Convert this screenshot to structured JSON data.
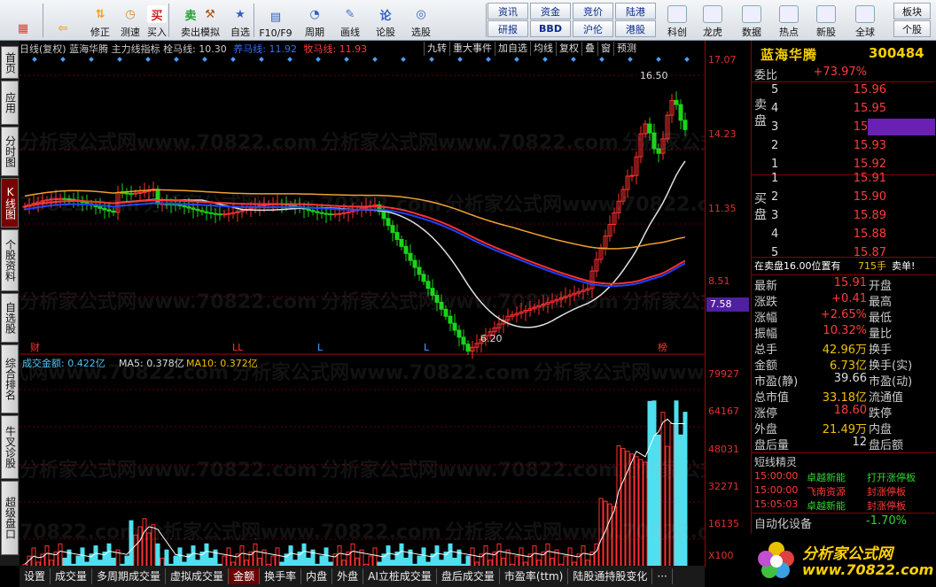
{
  "toolbar": {
    "items": [
      {
        "label": "",
        "icon": "grid-icon"
      },
      {
        "label": "",
        "icon": "back-arrow-icon"
      },
      {
        "label": "修正",
        "icon": "arrows-icon"
      },
      {
        "label": "测速",
        "icon": "clock-icon"
      },
      {
        "label": "买入",
        "icon": "buy-icon"
      },
      {
        "label": "卖出",
        "icon": "sell-icon"
      },
      {
        "label": "模拟",
        "icon": "hammer-icon"
      },
      {
        "label": "自选",
        "icon": "star-icon"
      },
      {
        "label": "F10/F9",
        "icon": "f10-icon"
      },
      {
        "label": "周期",
        "icon": "cycle-icon"
      },
      {
        "label": "画线",
        "icon": "pencil-icon"
      },
      {
        "label": "论股",
        "icon": "discuss-icon"
      },
      {
        "label": "选股",
        "icon": "select-icon"
      }
    ],
    "small": [
      [
        "资讯",
        "资金",
        "竞价",
        "陆港"
      ],
      [
        "研报",
        "BBD",
        "沪伦",
        "港股"
      ]
    ],
    "items2": [
      {
        "label": "科创",
        "icon": "chart-icon"
      },
      {
        "label": "龙虎",
        "icon": "dragon-icon"
      },
      {
        "label": "数据",
        "icon": "pe-icon"
      },
      {
        "label": "热点",
        "icon": "hot-icon"
      },
      {
        "label": "新股",
        "icon": "ipo-icon"
      },
      {
        "label": "全球",
        "icon": "globe-icon"
      }
    ],
    "right": [
      "板块",
      "个股"
    ]
  },
  "lefttabs": [
    "首页",
    "应用",
    "分时图",
    "K线图",
    "个股资料",
    "自选股",
    "综合排名",
    "牛叉诊股",
    "超级盘口"
  ],
  "chart_header": {
    "left": "日线(复权)  蓝海华腾  主力线指标  栓马线: 10.30",
    "yang": "养马线: 11.92",
    "mu": "牧马线: 11.93",
    "tabs": [
      "九转",
      "重大事件",
      "加自选",
      "均线",
      "复权",
      "叠",
      "窗",
      "预测"
    ]
  },
  "price_axis": [
    "17.07",
    "14.23",
    "11.35",
    "8.51"
  ],
  "price_tag": "7.58",
  "vol_axis": [
    "79927",
    "64167",
    "48031",
    "32271",
    "16135",
    "X100"
  ],
  "vol_header": {
    "a": "成交金额: 0.422亿",
    "b": "MA5: 0.378亿",
    "c": "MA10: 0.372亿"
  },
  "chart_labels": {
    "hi": "16.50",
    "lo": "6.20",
    "cai": "财",
    "bang": "榜",
    "l1": "LL",
    "l2": "L",
    "l3": "L"
  },
  "panel": {
    "name": "蓝海华腾",
    "code": "300484",
    "weibi_k": "委比",
    "weibi_v": "+73.97%",
    "sell_label": "卖盘",
    "buy_label": "买盘",
    "sell": [
      {
        "lv": "5",
        "p": "15.96"
      },
      {
        "lv": "4",
        "p": "15.95"
      },
      {
        "lv": "3",
        "p": "15.94"
      },
      {
        "lv": "2",
        "p": "15.93"
      },
      {
        "lv": "1",
        "p": "15.92"
      }
    ],
    "buy": [
      {
        "lv": "1",
        "p": "15.91"
      },
      {
        "lv": "2",
        "p": "15.90"
      },
      {
        "lv": "3",
        "p": "15.89"
      },
      {
        "lv": "4",
        "p": "15.88"
      },
      {
        "lv": "5",
        "p": "15.87"
      }
    ],
    "notice_a": "在卖盘16.00位置有",
    "notice_b": "715手",
    "notice_c": "卖单!",
    "stats": [
      {
        "k": "最新",
        "v": "15.91",
        "k2": "开盘"
      },
      {
        "k": "涨跌",
        "v": "+0.41",
        "k2": "最高"
      },
      {
        "k": "涨幅",
        "v": "+2.65%",
        "k2": "最低"
      },
      {
        "k": "振幅",
        "v": "10.32%",
        "k2": "量比"
      },
      {
        "k": "总手",
        "v": "42.96万",
        "k2": "换手"
      },
      {
        "k": "金额",
        "v": "6.73亿",
        "k2": "换手(实)"
      },
      {
        "k": "市盈(静)",
        "v": "39.66",
        "k2": "市盈(动)"
      },
      {
        "k": "总市值",
        "v": "33.18亿",
        "k2": "流通值"
      },
      {
        "k": "涨停",
        "v": "18.60",
        "k2": "跌停"
      },
      {
        "k": "外盘",
        "v": "21.49万",
        "k2": "内盘"
      },
      {
        "k": "盘后量",
        "v": "12",
        "k2": "盘后额"
      }
    ],
    "sp_title": "短线精灵",
    "sp": [
      {
        "t": "15:00:00",
        "s": "卓越新能",
        "e": "打开涨停板"
      },
      {
        "t": "15:00:00",
        "s": "飞南资源",
        "e": "封涨停板"
      },
      {
        "t": "15:05:03",
        "s": "卓越新能",
        "e": "封涨停板"
      }
    ],
    "bottom_k": "自动化设备",
    "bottom_v": "-1.70%"
  },
  "bottom_tabs": [
    "设置",
    "成交量",
    "多周期成交量",
    "虚拟成交量",
    "金额",
    "换手率",
    "内盘",
    "外盘",
    "AI立桩成交量",
    "盘后成交量",
    "市盈率(ttm)",
    "陆股通持股变化",
    "···"
  ],
  "active_bottom": "金额",
  "logo": {
    "l1": "分析家公式网",
    "l2": "www.70822.com"
  },
  "watermark": "分析家公式网www.70822.com"
}
